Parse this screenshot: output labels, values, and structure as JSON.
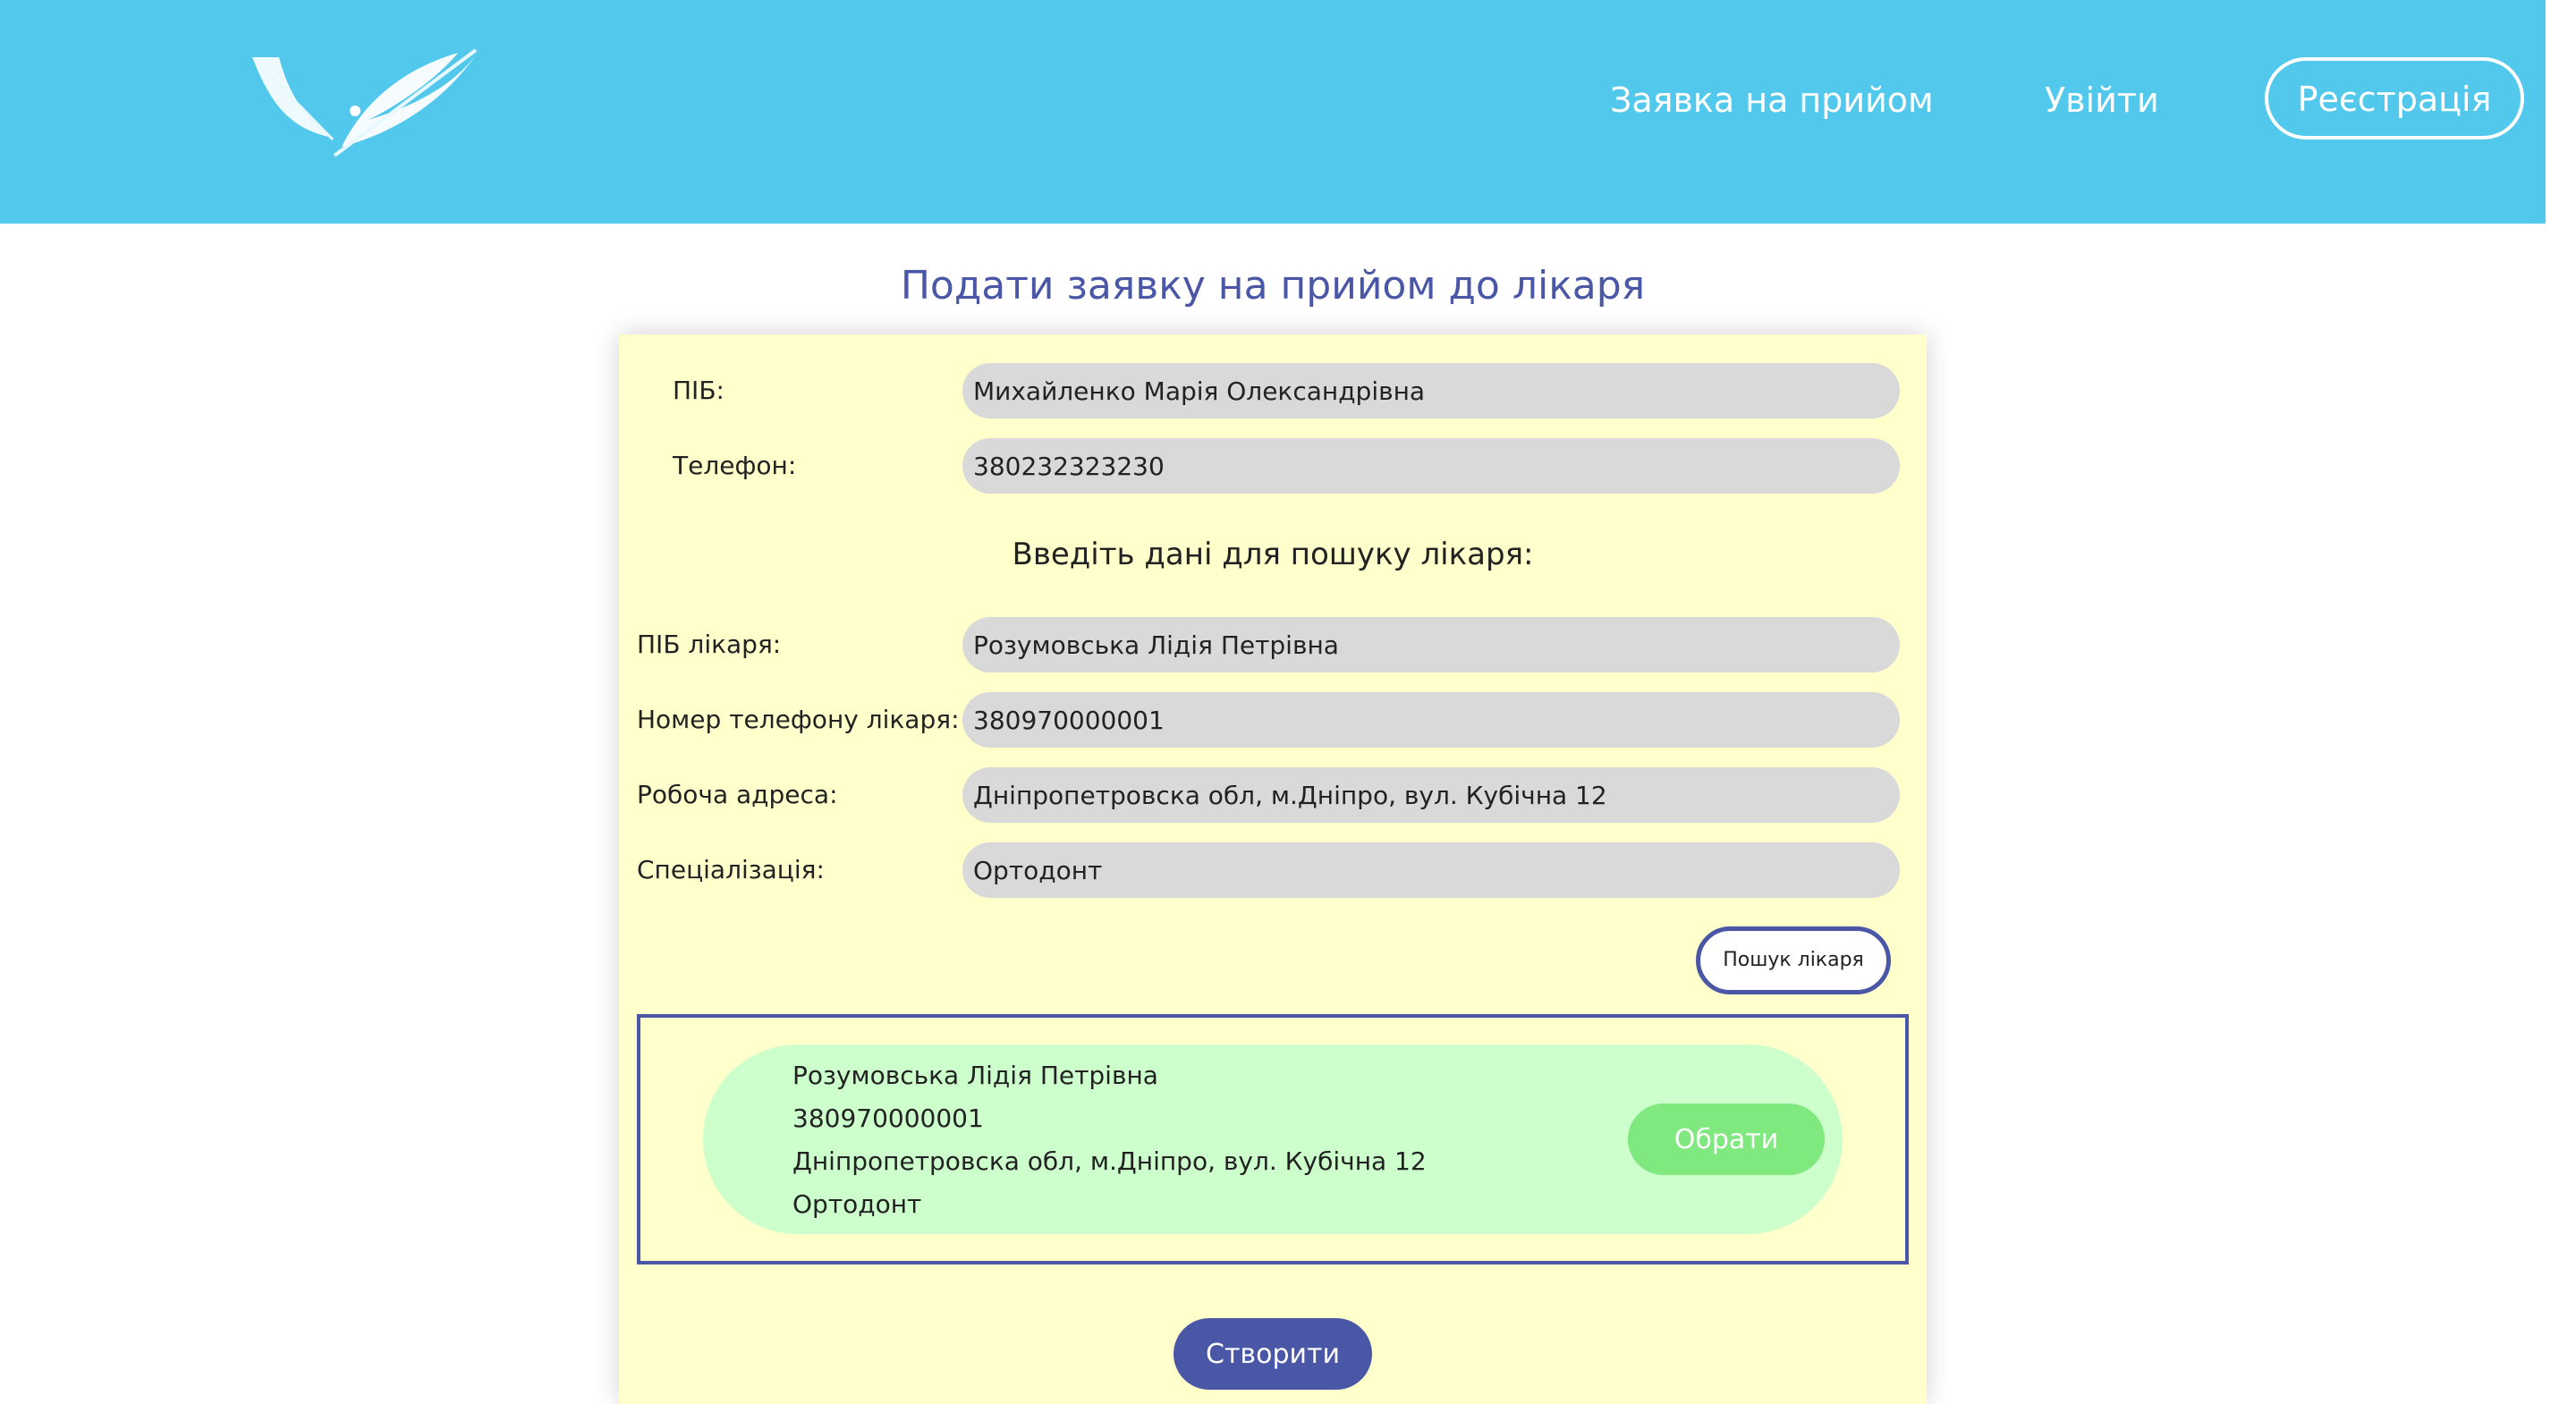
{
  "header": {
    "nav": {
      "appointment_request": "Заявка на прийом",
      "login": "Увійти",
      "register": "Реєстрація"
    },
    "background": "#52c9ec"
  },
  "page": {
    "title": "Подати заявку на прийом до лікаря"
  },
  "patient": {
    "name_label": "ПІБ:",
    "name_value": "Михайленко Марія Олександрівна",
    "phone_label": "Телефон:",
    "phone_value": "380232323230"
  },
  "doctor_search": {
    "section_title": "Введіть дані для пошуку лікаря:",
    "name_label": "ПІБ лікаря:",
    "name_value": "Розумовська Лідія Петрівна",
    "phone_label": "Номер телефону лікаря:",
    "phone_value": "380970000001",
    "address_label": "Робоча адреса:",
    "address_value": "Дніпропетровска обл, м.Дніпро, вул. Кубічна 12",
    "specialization_label": "Спеціалізація:",
    "specialization_value": "Ортодонт",
    "search_button": "Пошук лікаря"
  },
  "results": [
    {
      "name": "Розумовська Лідія Петрівна",
      "phone": "380970000001",
      "address": "Дніпропетровска обл, м.Дніпро, вул. Кубічна 12",
      "specialization": "Ортодонт",
      "choose_button": "Обрати"
    }
  ],
  "footer": {
    "create_button": "Створити"
  },
  "colors": {
    "accent": "#4a56a6",
    "card_background": "#ffffcc",
    "result_background": "#ccffcc",
    "choose_button": "#7fe87f",
    "field_background": "#d9d9d9"
  },
  "icons": {
    "logo": "feather-logo"
  }
}
